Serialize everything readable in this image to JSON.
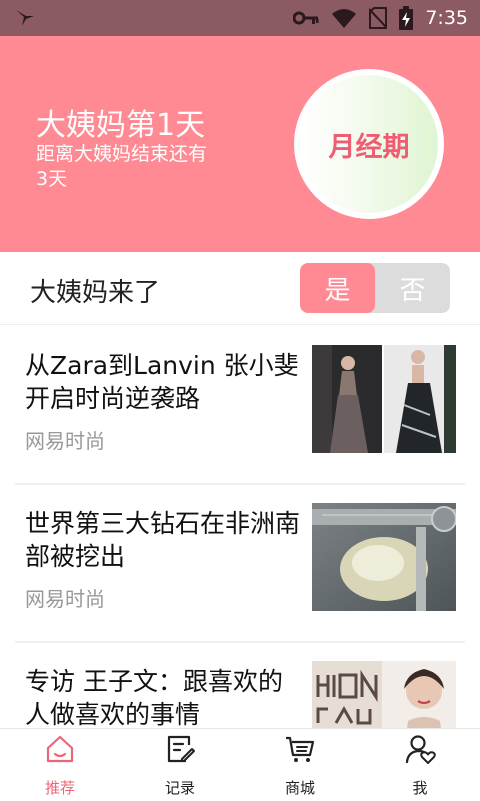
{
  "status_bar": {
    "time": "7:35",
    "icons": [
      "hummingbird-icon",
      "key-icon",
      "wifi-icon",
      "no-sim-icon",
      "battery-charging-icon"
    ]
  },
  "header": {
    "title": "大姨妈第1天",
    "subtitle": "距离大姨妈结束还有3天",
    "circle_label": "月经期",
    "background_color": "#ff8a93",
    "accent_color": "#ee5d72"
  },
  "toggle_row": {
    "label": "大姨妈来了",
    "options": [
      "是",
      "否"
    ],
    "selected": "是"
  },
  "news": [
    {
      "title": "从Zara到Lanvin 张小斐开启时尚逆袭路",
      "source": "网易时尚",
      "thumb": "red-carpet-dresses-photo"
    },
    {
      "title": "世界第三大钻石在非洲南部被挖出",
      "source": "网易时尚",
      "thumb": "diamond-caliper-photo"
    },
    {
      "title": "专访 王子文：跟喜欢的人做喜欢的事情",
      "source": "",
      "thumb": "fashion-magazine-portrait-photo"
    }
  ],
  "bottom_nav": [
    {
      "label": "推荐",
      "icon": "home-icon",
      "active": true
    },
    {
      "label": "记录",
      "icon": "edit-note-icon",
      "active": false
    },
    {
      "label": "商城",
      "icon": "shopping-cart-icon",
      "active": false
    },
    {
      "label": "我",
      "icon": "user-heart-icon",
      "active": false
    }
  ]
}
